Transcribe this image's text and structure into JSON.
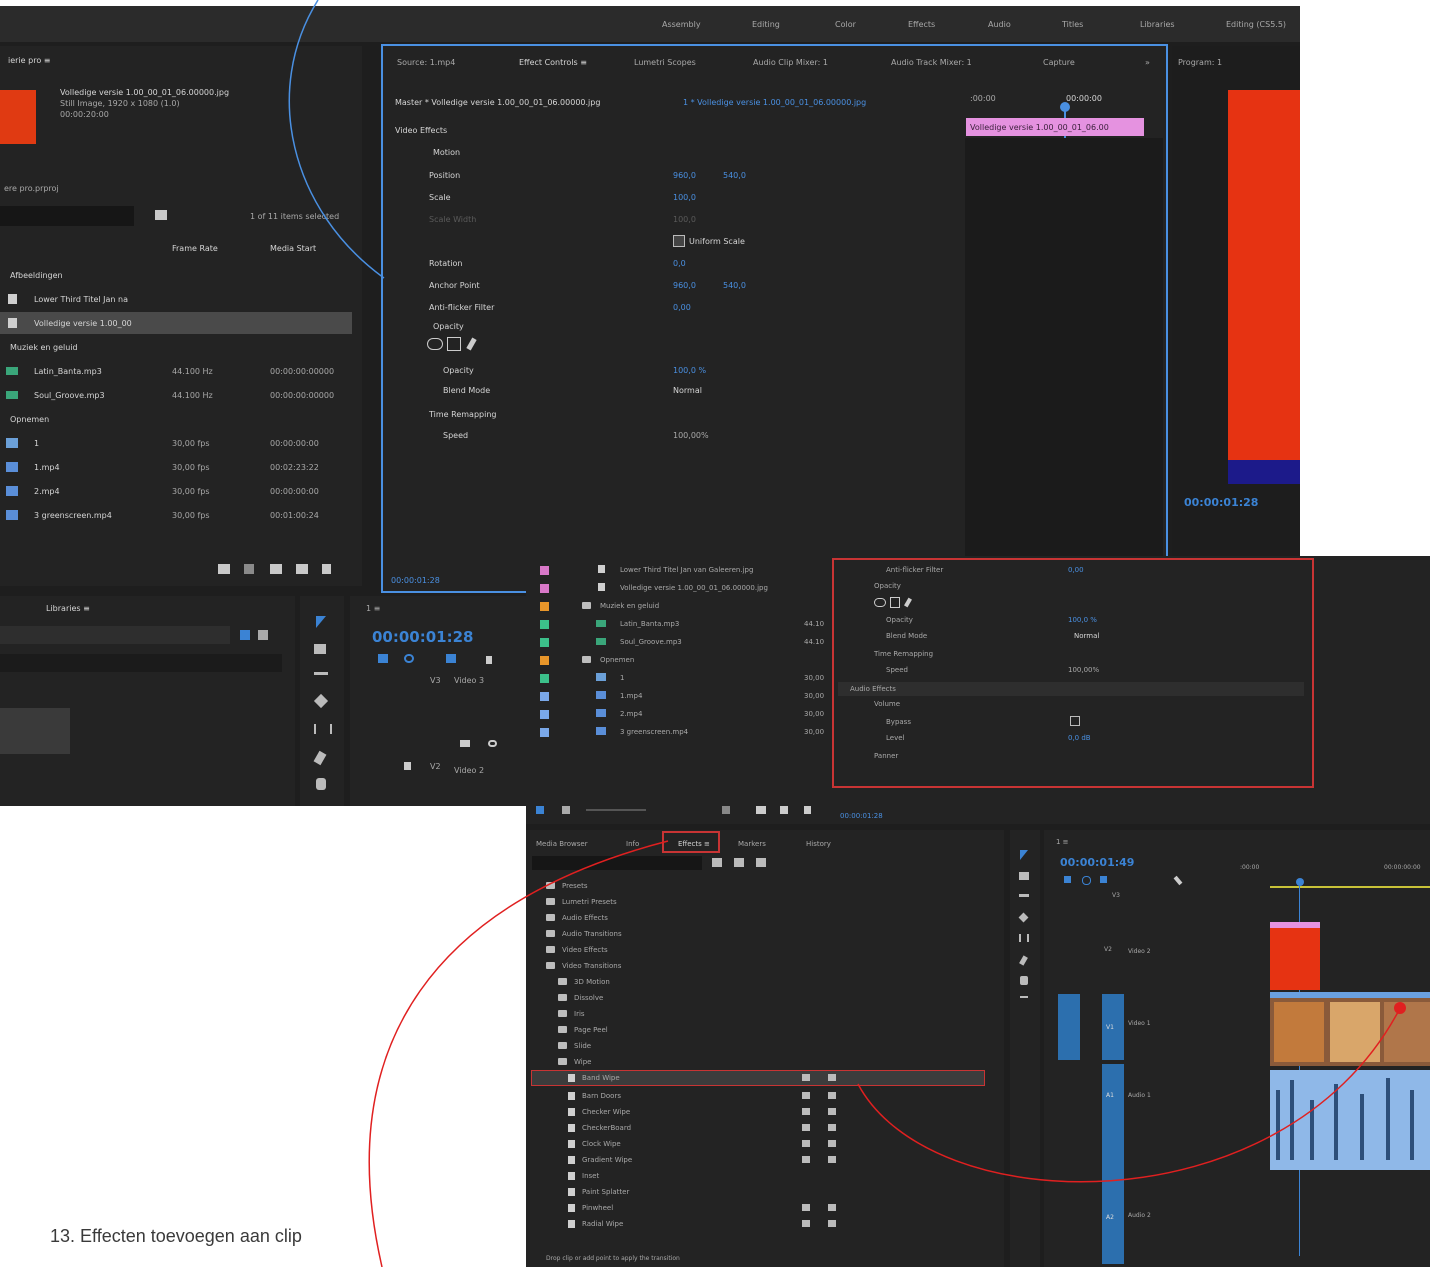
{
  "caption": "13. Effecten toevoegen aan clip",
  "workspace_tabs": [
    "Assembly",
    "Editing",
    "Color",
    "Effects",
    "Audio",
    "Titles",
    "Libraries",
    "Editing (CS5.5)"
  ],
  "project_panel": {
    "title": "ierie pro ≡",
    "clip_name": "Volledige versie 1.00_00_01_06.00000.jpg",
    "clip_info": "Still Image, 1920 x 1080 (1.0)",
    "clip_duration": "00:00:20:00",
    "project_name": "ere pro.prproj",
    "items_selected": "1 of 11 items selected",
    "col_frame_rate": "Frame Rate",
    "col_media_start": "Media Start",
    "rows": [
      {
        "name": "Afbeeldingen",
        "rate": "",
        "start": "",
        "kind": "bin"
      },
      {
        "name": "Lower Third Titel Jan na",
        "rate": "",
        "start": "",
        "kind": "file"
      },
      {
        "name": "Volledige versie 1.00_00",
        "rate": "",
        "start": "",
        "kind": "file"
      },
      {
        "name": "Muziek en geluid",
        "rate": "",
        "start": "",
        "kind": "bin"
      },
      {
        "name": "Latin_Banta.mp3",
        "rate": "44.100 Hz",
        "start": "00:00:00:00000",
        "kind": "audio"
      },
      {
        "name": "Soul_Groove.mp3",
        "rate": "44.100 Hz",
        "start": "00:00:00:00000",
        "kind": "audio"
      },
      {
        "name": "Opnemen",
        "rate": "",
        "start": "",
        "kind": "bin"
      },
      {
        "name": "1",
        "rate": "30,00 fps",
        "start": "00:00:00:00",
        "kind": "seq"
      },
      {
        "name": "1.mp4",
        "rate": "30,00 fps",
        "start": "00:02:23:22",
        "kind": "video"
      },
      {
        "name": "2.mp4",
        "rate": "30,00 fps",
        "start": "00:00:00:00",
        "kind": "video"
      },
      {
        "name": "3 greenscreen.mp4",
        "rate": "30,00 fps",
        "start": "00:01:00:24",
        "kind": "video"
      }
    ]
  },
  "libraries": {
    "tab": "Libraries ≡"
  },
  "effect_controls": {
    "tabs": [
      "Source: 1.mp4",
      "Effect Controls ≡",
      "Lumetri Scopes",
      "Audio Clip Mixer: 1",
      "Audio Track Mixer: 1",
      "Capture"
    ],
    "master": "Master * Volledige versie 1.00_00_01_06.00000.jpg",
    "sequence": "1 * Volledige versie 1.00_00_01_06.00000.jpg",
    "time_start": ":00:00",
    "time_cursor": "00:00:00",
    "clip_bar": "Volledige versie 1.00_00_01_06.00",
    "section_video": "Video Effects",
    "motion": "Motion",
    "props": [
      {
        "name": "Position",
        "v1": "960,0",
        "v2": "540,0"
      },
      {
        "name": "Scale",
        "v1": "100,0",
        "v2": ""
      },
      {
        "name": "Scale Width",
        "v1": "100,0",
        "v2": ""
      },
      {
        "name": "Uniform Scale",
        "v1": "",
        "v2": ""
      },
      {
        "name": "Rotation",
        "v1": "0,0",
        "v2": ""
      },
      {
        "name": "Anchor Point",
        "v1": "960,0",
        "v2": "540,0"
      },
      {
        "name": "Anti-flicker Filter",
        "v1": "0,00",
        "v2": ""
      }
    ],
    "opacity": "Opacity",
    "opacity_prop": "Opacity",
    "opacity_value": "100,0 %",
    "blend_mode": "Blend Mode",
    "blend_value": "Normal",
    "time_remap": "Time Remapping",
    "speed": "Speed",
    "speed_value": "100,00%",
    "footer_time": "00:00:01:28"
  },
  "program_monitor": {
    "tab": "Program: 1",
    "timecode": "00:00:01:28"
  },
  "timeline_top": {
    "timecode": "00:00:01:28",
    "tracks": [
      "V3",
      "Video 3",
      "V2",
      "Video 2"
    ]
  },
  "project_panel2": {
    "rows": [
      {
        "name": "Lower Third Titel Jan van Galeeren.jpg",
        "rate": "",
        "color": "#d878c8",
        "kind": "file",
        "indent": 1
      },
      {
        "name": "Volledige versie 1.00_00_01_06.00000.jpg",
        "rate": "",
        "color": "#d878c8",
        "kind": "file",
        "indent": 1
      },
      {
        "name": "Muziek en geluid",
        "rate": "",
        "color": "#e8962a",
        "kind": "bin",
        "indent": 0
      },
      {
        "name": "Latin_Banta.mp3",
        "rate": "44.10",
        "color": "#3cc08a",
        "kind": "audio",
        "indent": 1
      },
      {
        "name": "Soul_Groove.mp3",
        "rate": "44.10",
        "color": "#3cc08a",
        "kind": "audio",
        "indent": 1
      },
      {
        "name": "Opnemen",
        "rate": "",
        "color": "#e8962a",
        "kind": "bin",
        "indent": 0
      },
      {
        "name": "1",
        "rate": "30,00",
        "color": "#3cc08a",
        "kind": "seq",
        "indent": 1
      },
      {
        "name": "1.mp4",
        "rate": "30,00",
        "color": "#7aa8e8",
        "kind": "video",
        "indent": 1
      },
      {
        "name": "2.mp4",
        "rate": "30,00",
        "color": "#7aa8e8",
        "kind": "video",
        "indent": 1
      },
      {
        "name": "3 greenscreen.mp4",
        "rate": "30,00",
        "color": "#7aa8e8",
        "kind": "video",
        "indent": 1
      }
    ]
  },
  "effect_controls2": {
    "props": [
      {
        "name": "Anti-flicker Filter",
        "value": "0,00"
      },
      {
        "name": "Opacity",
        "value": ""
      },
      {
        "name": "Opacity",
        "value": "100,0 %"
      },
      {
        "name": "Blend Mode",
        "value": "Normal"
      },
      {
        "name": "Time Remapping",
        "value": ""
      },
      {
        "name": "Speed",
        "value": "100,00%"
      }
    ],
    "audio_effects": "Audio Effects",
    "volume": "Volume",
    "bypass": "Bypass",
    "level": "Level",
    "level_value": "0,0 dB",
    "panner": "Panner",
    "footer_time": "00:00:01:28"
  },
  "effects_panel": {
    "tabs": [
      "Media Browser",
      "Info",
      "Effects ≡",
      "Markers",
      "History"
    ],
    "tree": [
      {
        "label": "Presets",
        "level": 0,
        "open": false
      },
      {
        "label": "Lumetri Presets",
        "level": 0,
        "open": false
      },
      {
        "label": "Audio Effects",
        "level": 0,
        "open": false
      },
      {
        "label": "Audio Transitions",
        "level": 0,
        "open": false
      },
      {
        "label": "Video Effects",
        "level": 0,
        "open": false
      },
      {
        "label": "Video Transitions",
        "level": 0,
        "open": true
      },
      {
        "label": "3D Motion",
        "level": 1,
        "open": false
      },
      {
        "label": "Dissolve",
        "level": 1,
        "open": false
      },
      {
        "label": "Iris",
        "level": 1,
        "open": false
      },
      {
        "label": "Page Peel",
        "level": 1,
        "open": false
      },
      {
        "label": "Slide",
        "level": 1,
        "open": false
      },
      {
        "label": "Wipe",
        "level": 1,
        "open": true
      },
      {
        "label": "Band Wipe",
        "level": 2,
        "open": false
      },
      {
        "label": "Barn Doors",
        "level": 2,
        "open": false
      },
      {
        "label": "Checker Wipe",
        "level": 2,
        "open": false
      },
      {
        "label": "CheckerBoard",
        "level": 2,
        "open": false
      },
      {
        "label": "Clock Wipe",
        "level": 2,
        "open": false
      },
      {
        "label": "Gradient Wipe",
        "level": 2,
        "open": false
      },
      {
        "label": "Inset",
        "level": 2,
        "open": false
      },
      {
        "label": "Paint Splatter",
        "level": 2,
        "open": false
      },
      {
        "label": "Pinwheel",
        "level": 2,
        "open": false
      },
      {
        "label": "Radial Wipe",
        "level": 2,
        "open": false
      }
    ],
    "status": "Drop clip or add point to apply the transition"
  },
  "timeline_bottom": {
    "timecode": "00:00:01:49",
    "ruler": [
      ":00:00",
      "00:00:00:00"
    ],
    "tracks": [
      {
        "id": "V3",
        "name": ""
      },
      {
        "id": "V2",
        "name": "Video 2"
      },
      {
        "id": "V1",
        "name": "Video 1"
      },
      {
        "id": "A1",
        "name": "Audio 1"
      },
      {
        "id": "A2",
        "name": "Audio 2"
      }
    ]
  }
}
